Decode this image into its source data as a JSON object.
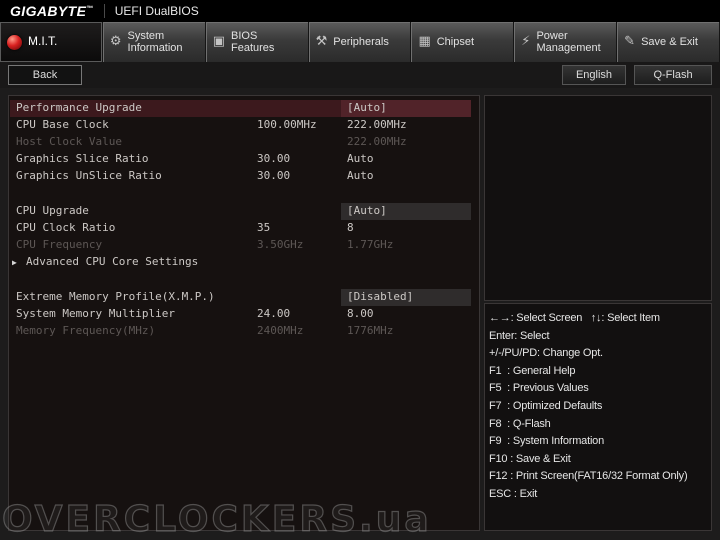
{
  "header": {
    "brand": "GIGABYTE",
    "brand_mark": "™",
    "title": "UEFI DualBIOS"
  },
  "tabs": [
    {
      "id": "mit",
      "label": "M.I.T.",
      "icon": "mit-sphere-icon",
      "glyph": "",
      "active": true
    },
    {
      "id": "system-information",
      "label": "System Information",
      "icon": "wrench-gear-icon",
      "glyph": "⚙",
      "active": false
    },
    {
      "id": "bios-features",
      "label": "BIOS Features",
      "icon": "bios-chip-icon",
      "glyph": "▣",
      "active": false
    },
    {
      "id": "peripherals",
      "label": "Peripherals",
      "icon": "peripherals-icon",
      "glyph": "⚒",
      "active": false
    },
    {
      "id": "chipset",
      "label": "Chipset",
      "icon": "chipset-icon",
      "glyph": "▦",
      "active": false
    },
    {
      "id": "power-management",
      "label": "Power Management",
      "icon": "power-gear-icon",
      "glyph": "⚡",
      "active": false
    },
    {
      "id": "save-exit",
      "label": "Save & Exit",
      "icon": "save-exit-icon",
      "glyph": "✎",
      "active": false
    }
  ],
  "toolbar": {
    "back_label": "Back",
    "language_label": "English",
    "qflash_label": "Q-Flash"
  },
  "settings": [
    {
      "label": "Performance Upgrade",
      "current": "[Auto]",
      "highlighted": true,
      "boxed": true
    },
    {
      "label": "CPU Base Clock",
      "value": "100.00MHz",
      "current": "222.00MHz"
    },
    {
      "label": "Host Clock Value",
      "current": "222.00MHz",
      "disabled": true
    },
    {
      "label": "Graphics Slice Ratio",
      "value": "30.00",
      "current": "Auto"
    },
    {
      "label": "Graphics UnSlice Ratio",
      "value": "30.00",
      "current": "Auto"
    },
    {
      "label": "CPU Upgrade",
      "current": "[Auto]",
      "boxed": true,
      "gap_before": true
    },
    {
      "label": "CPU Clock Ratio",
      "value": "35",
      "current": "8"
    },
    {
      "label": "CPU Frequency",
      "value": "3.50GHz",
      "current": "1.77GHz",
      "disabled": true
    },
    {
      "label": "Advanced CPU Core Settings",
      "arrow": true
    },
    {
      "label": "Extreme Memory Profile(X.M.P.)",
      "current": "[Disabled]",
      "boxed": true,
      "gap_before": true
    },
    {
      "label": "System Memory Multiplier",
      "value": "24.00",
      "current": "8.00"
    },
    {
      "label": "Memory Frequency(MHz)",
      "value": "2400MHz",
      "current": "1776MHz",
      "disabled": true
    }
  ],
  "help_lines": [
    "←→: Select Screen   ↑↓: Select Item",
    "Enter: Select",
    "+/-/PU/PD: Change Opt.",
    "F1  : General Help",
    "F5  : Previous Values",
    "F7  : Optimized Defaults",
    "F8  : Q-Flash",
    "F9  : System Information",
    "F10 : Save & Exit",
    "F12 : Print Screen(FAT16/32 Format Only)",
    "ESC : Exit"
  ],
  "icons": {
    "expand_arrow": "▶"
  },
  "watermark": "OVERCLOCKERS.ua",
  "colors": {
    "accent_red": "#d92020",
    "highlight_row": "#3c191d",
    "panel_bg": "#161110",
    "text": "#ccc8c5",
    "text_disabled": "#5d5755"
  }
}
